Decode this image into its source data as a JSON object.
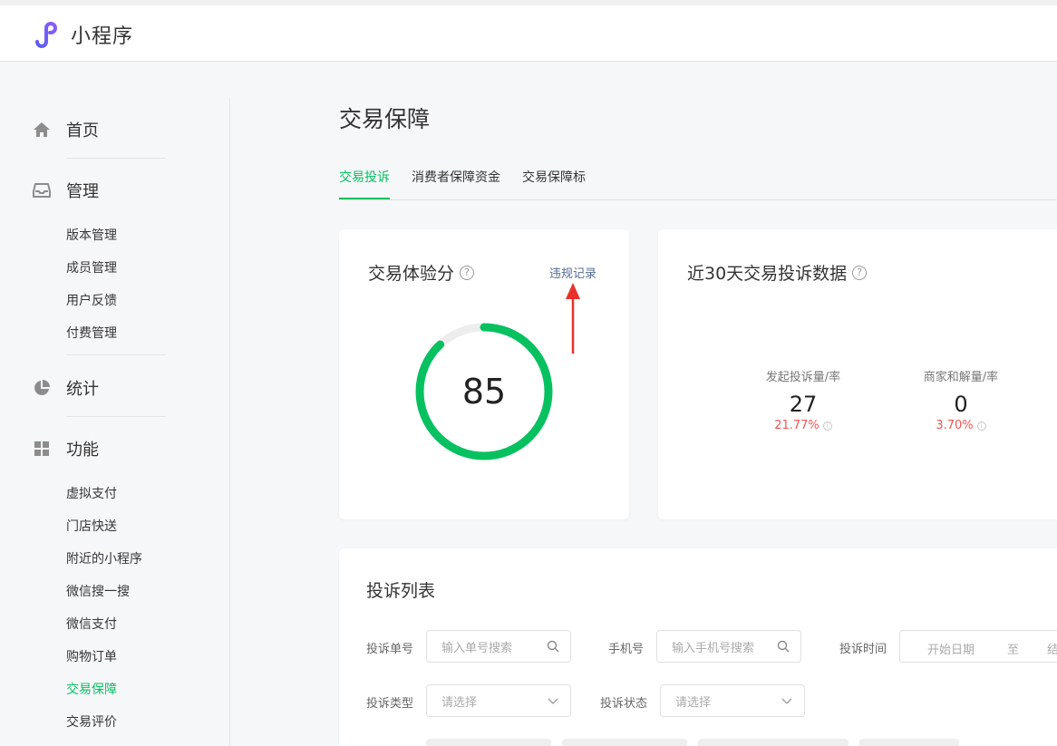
{
  "app": {
    "name": "小程序"
  },
  "sidebar": {
    "home": "首页",
    "manage": {
      "label": "管理",
      "items": [
        "版本管理",
        "成员管理",
        "用户反馈",
        "付费管理"
      ]
    },
    "stats": "统计",
    "features": {
      "label": "功能",
      "items": [
        "虚拟支付",
        "门店快送",
        "附近的小程序",
        "微信搜一搜",
        "微信支付",
        "购物订单",
        "交易保障",
        "交易评价"
      ],
      "active_item": "交易保障"
    }
  },
  "page": {
    "title": "交易保障"
  },
  "tabs": [
    "交易投诉",
    "消费者保障资金",
    "交易保障标"
  ],
  "active_tab": "交易投诉",
  "score_card": {
    "title": "交易体验分",
    "link": "违规记录",
    "score": "85",
    "score_fraction": 0.88
  },
  "stats_card": {
    "title": "近30天交易投诉数据",
    "stats": [
      {
        "label": "发起投诉量/率",
        "value": "27",
        "rate": "21.77%"
      },
      {
        "label": "商家和解量/率",
        "value": "0",
        "rate": "3.70%"
      }
    ]
  },
  "complaint_list": {
    "title": "投诉列表",
    "order_no": {
      "label": "投诉单号",
      "placeholder": "输入单号搜索"
    },
    "phone": {
      "label": "手机号",
      "placeholder": "输入手机号搜索"
    },
    "time": {
      "label": "投诉时间",
      "start": "开始日期",
      "sep": "至",
      "end": "结"
    },
    "type": {
      "label": "投诉类型",
      "placeholder": "请选择"
    },
    "status": {
      "label": "投诉状态",
      "placeholder": "请选择"
    }
  },
  "colors": {
    "accent": "#07c160",
    "link": "#576b95",
    "danger": "#fa5151",
    "annotation_arrow": "#e8312a"
  }
}
